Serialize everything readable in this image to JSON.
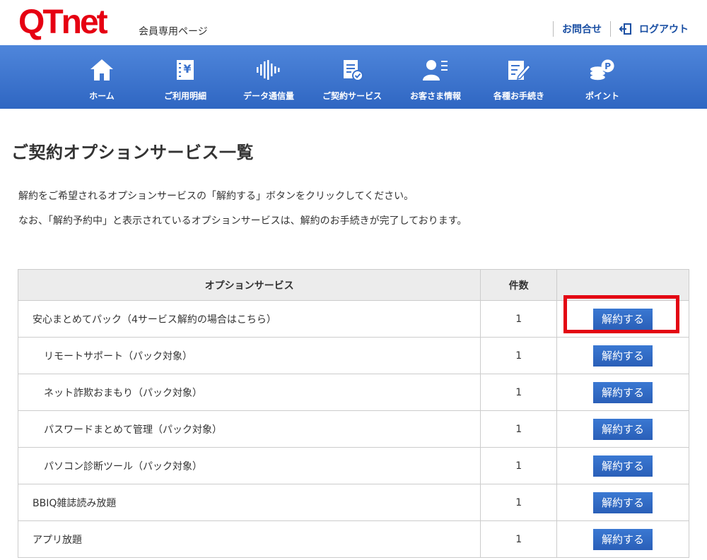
{
  "header": {
    "logo_q": "Q",
    "logo_rest": "Tnet",
    "member_label": "会員専用ページ",
    "contact_label": "お問合せ",
    "logout_label": "ログアウト"
  },
  "nav": {
    "items": [
      {
        "label": "ホーム",
        "icon": "home-icon"
      },
      {
        "label": "ご利用明細",
        "icon": "billing-icon"
      },
      {
        "label": "データ通信量",
        "icon": "data-usage-icon"
      },
      {
        "label": "ご契約サービス",
        "icon": "contract-icon"
      },
      {
        "label": "お客さま情報",
        "icon": "user-info-icon"
      },
      {
        "label": "各種お手続き",
        "icon": "procedure-icon"
      },
      {
        "label": "ポイント",
        "icon": "points-icon"
      }
    ]
  },
  "page": {
    "title": "ご契約オプションサービス一覧",
    "desc1": "解約をご希望されるオプションサービスの「解約する」ボタンをクリックしてください。",
    "desc2": "なお、「解約予約中」と表示されているオプションサービスは、解約のお手続きが完了しております。"
  },
  "table": {
    "headers": {
      "service": "オプションサービス",
      "count": "件数",
      "action": ""
    },
    "rows": [
      {
        "name": "安心まとめてパック（4サービス解約の場合はこちら）",
        "count": "1",
        "button": "解約する"
      },
      {
        "name": "リモートサポート（パック対象）",
        "count": "1",
        "button": "解約する"
      },
      {
        "name": "ネット詐欺おまもり（パック対象）",
        "count": "1",
        "button": "解約する"
      },
      {
        "name": "パスワードまとめて管理（パック対象）",
        "count": "1",
        "button": "解約する"
      },
      {
        "name": "パソコン診断ツール（パック対象）",
        "count": "1",
        "button": "解約する"
      },
      {
        "name": "BBIQ雑誌読み放題",
        "count": "1",
        "button": "解約する"
      },
      {
        "name": "アプリ放題",
        "count": "1",
        "button": "解約する"
      }
    ]
  },
  "colors": {
    "brand_red": "#e60012",
    "nav_blue": "#3a72cd",
    "link_blue": "#1a4fa3",
    "highlight": "#e30613"
  }
}
